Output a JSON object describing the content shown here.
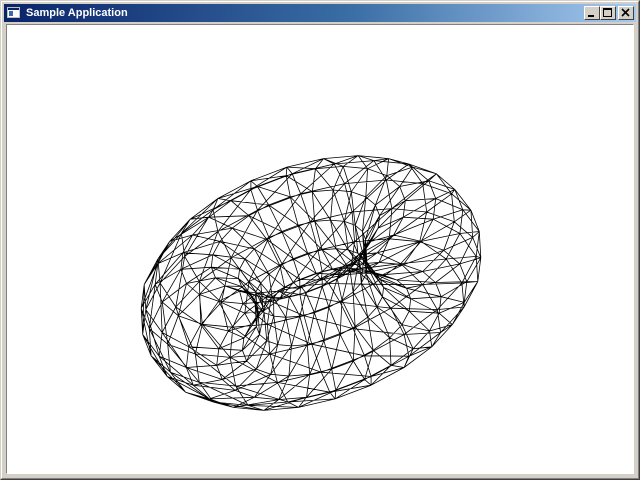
{
  "window": {
    "title": "Sample Application",
    "app_icon": "application-window-icon",
    "buttons": {
      "minimize_icon": "minimize-icon",
      "maximize_icon": "maximize-icon",
      "close_icon": "close-icon"
    }
  },
  "viewport": {
    "background": "#ffffff",
    "object": "wireframe-torus",
    "line_color": "#000000"
  },
  "colors": {
    "titlebar_start": "#0a246a",
    "titlebar_end": "#a6caf0",
    "face": "#d4d0c8"
  }
}
